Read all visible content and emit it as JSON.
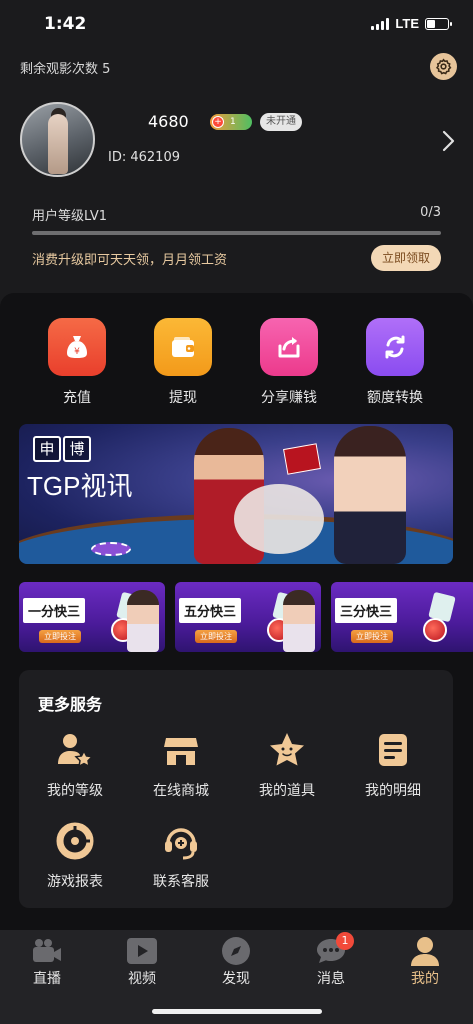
{
  "status_bar": {
    "time": "1:42",
    "network": "LTE"
  },
  "header": {
    "remaining_views": "剩余观影次数 5"
  },
  "profile": {
    "username": "4680",
    "vip_level": "1",
    "open_status": "未开通",
    "user_id": "ID: 462109"
  },
  "level": {
    "label": "用户等级LV1",
    "progress_text": "0/3",
    "progress": 0,
    "tip": "消费升级即可天天领，月月领工资",
    "claim_label": "立即领取"
  },
  "actions": [
    {
      "label": "充值",
      "icon": "money-bag-icon",
      "color": "#f0553c"
    },
    {
      "label": "提现",
      "icon": "wallet-icon",
      "color": "#f7a823"
    },
    {
      "label": "分享赚钱",
      "icon": "share-icon",
      "color": "#f0479a"
    },
    {
      "label": "额度转换",
      "icon": "refresh-icon",
      "color": "#9b5cf6"
    }
  ],
  "banner": {
    "badge": [
      "申",
      "博"
    ],
    "title": "TGP视讯"
  },
  "games": [
    {
      "title": "一分快三",
      "button": "立即投注"
    },
    {
      "title": "五分快三",
      "button": "立即投注"
    },
    {
      "title": "三分快三",
      "button": "立即投注"
    }
  ],
  "services": {
    "title": "更多服务",
    "items": [
      {
        "label": "我的等级",
        "icon": "user-star-icon"
      },
      {
        "label": "在线商城",
        "icon": "store-icon"
      },
      {
        "label": "我的道具",
        "icon": "star-icon"
      },
      {
        "label": "我的明细",
        "icon": "document-icon"
      },
      {
        "label": "游戏报表",
        "icon": "pie-chart-icon"
      },
      {
        "label": "联系客服",
        "icon": "headset-icon"
      }
    ]
  },
  "tabbar": {
    "items": [
      {
        "label": "直播",
        "icon": "video-camera-icon"
      },
      {
        "label": "视频",
        "icon": "play-icon"
      },
      {
        "label": "发现",
        "icon": "compass-icon"
      },
      {
        "label": "消息",
        "icon": "chat-icon",
        "badge": "1"
      },
      {
        "label": "我的",
        "icon": "user-icon",
        "active": true
      }
    ]
  },
  "colors": {
    "accent": "#e8c08a",
    "background": "#1b1b1d",
    "panel": "#111113"
  }
}
